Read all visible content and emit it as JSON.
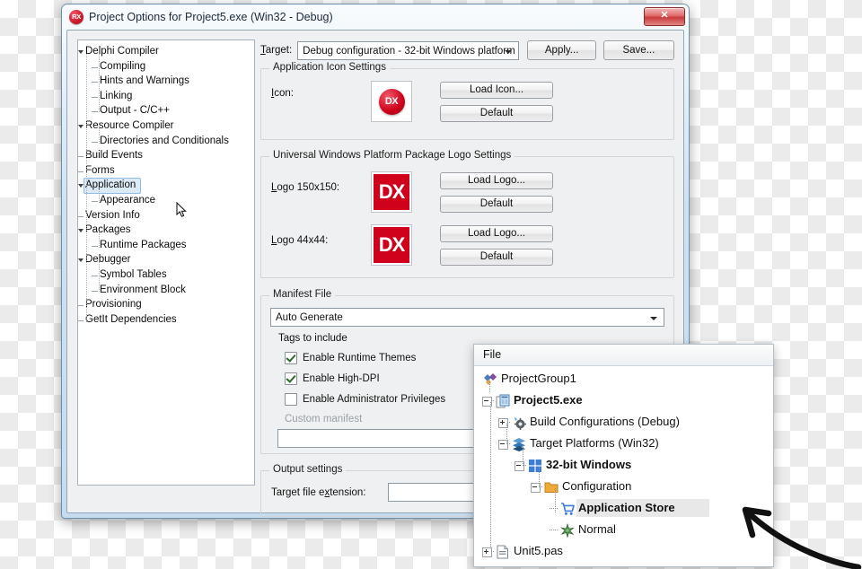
{
  "dialog": {
    "title": "Project Options for Project5.exe  (Win32 - Debug)",
    "app_icon": "rx-icon",
    "app_icon_text": "RX",
    "close_label": "✕"
  },
  "tree": {
    "items": [
      {
        "label": "Delphi Compiler",
        "depth": 0,
        "expander": "expanded",
        "selected": false
      },
      {
        "label": "Compiling",
        "depth": 1,
        "expander": "none",
        "selected": false
      },
      {
        "label": "Hints and Warnings",
        "depth": 1,
        "expander": "none",
        "selected": false
      },
      {
        "label": "Linking",
        "depth": 1,
        "expander": "none",
        "selected": false
      },
      {
        "label": "Output - C/C++",
        "depth": 1,
        "expander": "none",
        "selected": false
      },
      {
        "label": "Resource Compiler",
        "depth": 0,
        "expander": "expanded",
        "selected": false
      },
      {
        "label": "Directories and Conditionals",
        "depth": 1,
        "expander": "none",
        "selected": false
      },
      {
        "label": "Build Events",
        "depth": 0,
        "expander": "none",
        "selected": false
      },
      {
        "label": "Forms",
        "depth": 0,
        "expander": "none",
        "selected": false
      },
      {
        "label": "Application",
        "depth": 0,
        "expander": "expanded",
        "selected": true
      },
      {
        "label": "Appearance",
        "depth": 1,
        "expander": "none",
        "selected": false
      },
      {
        "label": "Version Info",
        "depth": 0,
        "expander": "none",
        "selected": false
      },
      {
        "label": "Packages",
        "depth": 0,
        "expander": "expanded",
        "selected": false
      },
      {
        "label": "Runtime Packages",
        "depth": 1,
        "expander": "none",
        "selected": false
      },
      {
        "label": "Debugger",
        "depth": 0,
        "expander": "expanded",
        "selected": false
      },
      {
        "label": "Symbol Tables",
        "depth": 1,
        "expander": "none",
        "selected": false
      },
      {
        "label": "Environment Block",
        "depth": 1,
        "expander": "none",
        "selected": false
      },
      {
        "label": "Provisioning",
        "depth": 0,
        "expander": "none",
        "selected": false
      },
      {
        "label": "GetIt Dependencies",
        "depth": 0,
        "expander": "none",
        "selected": false
      }
    ]
  },
  "toolbar": {
    "target_label": "Target:",
    "target_value": "Debug configuration - 32-bit Windows platform",
    "apply_label": "Apply...",
    "save_label": "Save..."
  },
  "icon_settings": {
    "caption": "Application Icon Settings",
    "icon_label": "Icon:",
    "preview_text": "DX",
    "load_label": "Load Icon...",
    "default_label": "Default"
  },
  "uwp_settings": {
    "caption": "Universal Windows Platform Package Logo Settings",
    "logos": [
      {
        "label": "Logo 150x150:",
        "preview_text": "DX",
        "load_label": "Load Logo...",
        "default_label": "Default"
      },
      {
        "label": "Logo 44x44:",
        "preview_text": "DX",
        "load_label": "Load Logo...",
        "default_label": "Default"
      }
    ]
  },
  "manifest": {
    "caption": "Manifest File",
    "mode_value": "Auto Generate",
    "tags_label": "Tags to include",
    "checkboxes": [
      {
        "label": "Enable Runtime Themes",
        "checked": true
      },
      {
        "label": "Enable High-DPI",
        "checked": true
      },
      {
        "label": "Enable Administrator Privileges",
        "checked": false
      }
    ],
    "custom_label": "Custom manifest",
    "custom_value": ""
  },
  "output_settings": {
    "caption": "Output settings",
    "ext_label": "Target file extension:",
    "ext_value": ""
  },
  "project_manager": {
    "header": "File",
    "nodes": [
      {
        "label": "ProjectGroup1",
        "depth": 0,
        "bold": false,
        "icon": "project-group-icon",
        "expander": "none",
        "selected": false
      },
      {
        "label": "Project5.exe",
        "depth": 1,
        "bold": true,
        "icon": "project-exe-icon",
        "expander": "minus",
        "selected": false
      },
      {
        "label": "Build Configurations (Debug)",
        "depth": 2,
        "bold": false,
        "icon": "gear-icon",
        "expander": "plus",
        "selected": false
      },
      {
        "label": "Target Platforms (Win32)",
        "depth": 2,
        "bold": false,
        "icon": "layers-icon",
        "expander": "minus",
        "selected": false
      },
      {
        "label": "32-bit Windows",
        "depth": 3,
        "bold": true,
        "icon": "windows-icon",
        "expander": "minus",
        "selected": false
      },
      {
        "label": "Configuration",
        "depth": 4,
        "bold": false,
        "icon": "folder-icon",
        "expander": "minus",
        "selected": false
      },
      {
        "label": "Application Store",
        "depth": 5,
        "bold": true,
        "icon": "cart-icon",
        "expander": "none",
        "selected": true
      },
      {
        "label": "Normal",
        "depth": 5,
        "bold": false,
        "icon": "burst-icon",
        "expander": "none",
        "selected": false
      },
      {
        "label": "Unit5.pas",
        "depth": 1,
        "bold": false,
        "icon": "unit-file-icon",
        "expander": "plus",
        "selected": false
      }
    ]
  },
  "annotation": {
    "type": "curved-arrow",
    "points_to": "Application Store",
    "color": "#111111"
  },
  "colors": {
    "brand_red": "#d0021b",
    "selection_blue": "#dceaf7",
    "window_blue": "#cfe2f2"
  }
}
